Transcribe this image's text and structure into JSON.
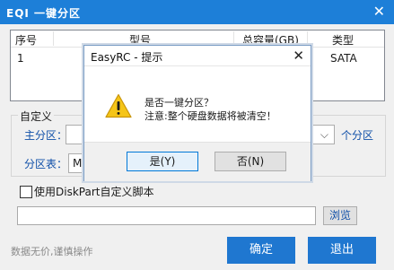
{
  "main": {
    "title": "EQI 一键分区",
    "close_glyph": "✕",
    "table": {
      "headers": [
        "序号",
        "型号",
        "总容量(GB)",
        "类型"
      ],
      "rows": [
        {
          "index": "1",
          "type": "SATA"
        }
      ]
    },
    "custom_group": {
      "legend": "自定义",
      "primary_label": "主分区：",
      "primary_unit": "个分区",
      "table_label": "分区表：",
      "table_value": "MB"
    },
    "diskpart": {
      "checkbox_label": "使用DiskPart自定义脚本",
      "checked": false,
      "script_value": "",
      "browse_label": "浏览"
    },
    "footer_note": "数据无价,谨慎操作",
    "confirm_label": "确定",
    "exit_label": "退出"
  },
  "dialog": {
    "title": "EasyRC - 提示",
    "close_glyph": "✕",
    "icon": "warning-icon",
    "line1": "是否一键分区？",
    "line2": "注意:整个硬盘数据将被清空！",
    "yes_label": "是(Y)",
    "no_label": "否(N)"
  },
  "colors": {
    "titlebar": "#1d7fd8",
    "primary_button": "#1f77d0",
    "label_blue": "#0f4fa8",
    "warning_yellow": "#f5c518"
  }
}
